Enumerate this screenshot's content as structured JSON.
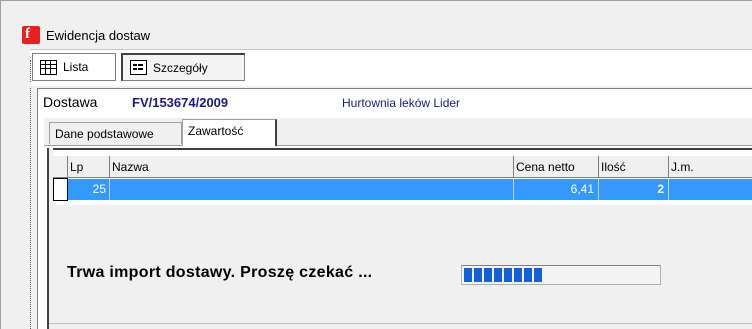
{
  "window": {
    "title": "Ewidencja dostaw",
    "icon": "app-logo-icon",
    "accent": "#e8211f"
  },
  "view_tabs": [
    {
      "label": "Lista",
      "icon": "grid-icon",
      "selected": false
    },
    {
      "label": "Szczegóły",
      "icon": "form-icon",
      "selected": true
    }
  ],
  "header": {
    "label": "Dostawa",
    "number": "FV/153674/2009",
    "supplier": "Hurtownia leków Lider"
  },
  "inner_tabs": [
    {
      "label": "Dane podstawowe",
      "selected": false
    },
    {
      "label": "Zawartość",
      "selected": true
    }
  ],
  "table": {
    "columns": [
      "Lp",
      "Nazwa",
      "Cena netto",
      "Ilość",
      "J.m."
    ],
    "rows": [
      {
        "lp": "25",
        "nazwa": "",
        "cena_netto": "6,41",
        "ilosc": "2",
        "jm": "",
        "selected": true
      }
    ],
    "selection_color": "#3399ff"
  },
  "progress": {
    "message": "Trwa import dostawy. Proszę czekać ...",
    "value": 0.4,
    "bar_color": "#1560d8"
  }
}
